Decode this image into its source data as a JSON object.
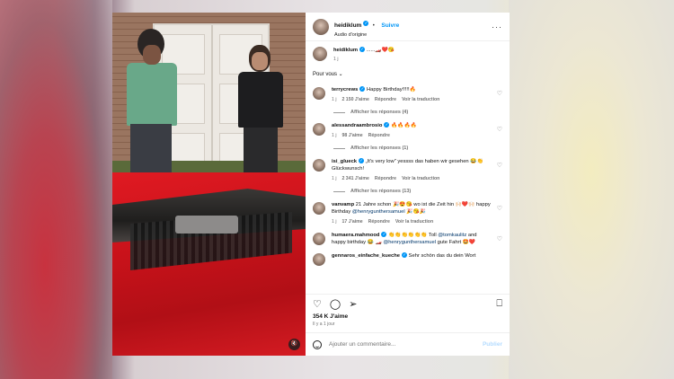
{
  "header": {
    "username": "heidiklum",
    "verified_badge": "✓",
    "follow_label": "Suivre",
    "separator": "•",
    "audio": "Audio d'origine",
    "more_icon": "more-dots-icon"
  },
  "caption": {
    "username": "heidiklum",
    "text": "......🏎️❤️😘",
    "time": "1 j"
  },
  "pour_vous_label": "Pour vous ⌄",
  "comments": [
    {
      "username": "terrycrews",
      "verified": true,
      "text": "Happy Birthday!!!!!🔥",
      "time": "1 j",
      "likes": "2 150 J'aime",
      "reply": "Répondre",
      "translate": "Voir la traduction",
      "replies": "Afficher les réponses (4)"
    },
    {
      "username": "alessandraambrosio",
      "verified": true,
      "text": "🔥🔥🔥🔥",
      "time": "1 j",
      "likes": "98 J'aime",
      "reply": "Répondre",
      "translate": "",
      "replies": "Afficher les réponses (1)"
    },
    {
      "username": "isi_glueck",
      "verified": true,
      "text": "„It's very low\" yessss das haben wir gesehen 😂👏 Glückwunsch!",
      "time": "1 j",
      "likes": "2 341 J'aime",
      "reply": "Répondre",
      "translate": "Voir la traduction",
      "replies": "Afficher les réponses (13)"
    },
    {
      "username": "vanvamp",
      "verified": false,
      "text": "21 Jahre schon 🎉😍😘 wo ist die Zeit hin 🙌🏻❤️🙌🏻 happy Birthday",
      "mention": "@henrygunthersamuel",
      "tail": "🎉😘🎉",
      "time": "1 j",
      "likes": "17 J'aime",
      "reply": "Répondre",
      "translate": "Voir la traduction"
    },
    {
      "username": "humaera.mahmood",
      "verified": true,
      "text": "👏👏👏👏👏👏 Toll",
      "mention": "@tomkaulitz",
      "tail": "and happy birthday 😂 🏎️",
      "mention2": "@henrygunthersamuel",
      "tail2": "gute Fahrt 🤩❤️",
      "time": "1 j",
      "likes": "",
      "reply": "Répondre",
      "translate": "Voir la traduction"
    },
    {
      "username": "gennaros_einfache_kueche",
      "verified": true,
      "text": "Sehr schön das du dein Wort",
      "time": "",
      "likes": "",
      "reply": "",
      "translate": ""
    }
  ],
  "actions": {
    "like_icon": "heart-icon",
    "comment_icon": "comment-icon",
    "share_icon": "share-icon",
    "save_icon": "bookmark-icon"
  },
  "likes_count": "354 K J'aime",
  "posted_ago": "Il y a 1 jour",
  "composer": {
    "placeholder": "Ajouter un commentaire...",
    "publish_label": "Publier"
  },
  "video": {
    "mute_icon": "speaker-muted-icon"
  }
}
